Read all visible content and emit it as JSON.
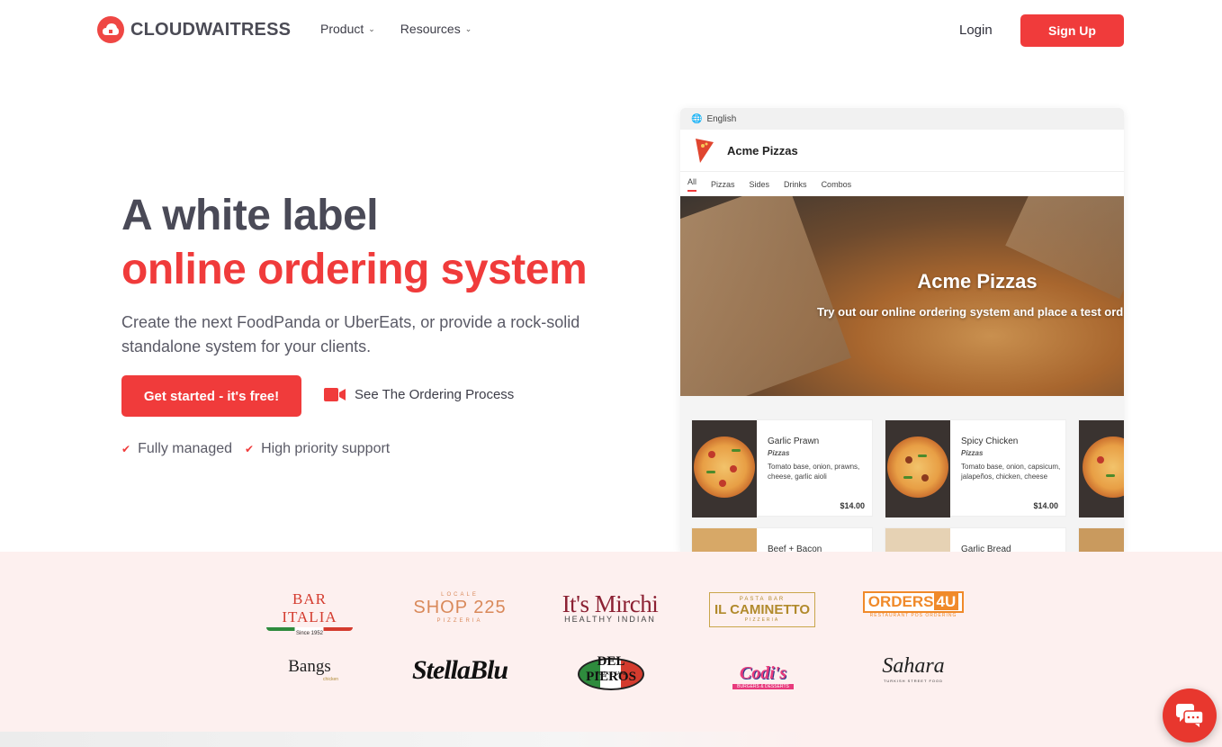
{
  "header": {
    "logo_text": "CLOUDWAITRESS",
    "nav": [
      {
        "label": "Product"
      },
      {
        "label": "Resources"
      }
    ],
    "login_label": "Login",
    "signup_label": "Sign Up"
  },
  "hero": {
    "title_line1": "A white label",
    "title_line2": "online ordering system",
    "subtitle": "Create the next FoodPanda or UberEats, or provide a rock-solid standalone system for your clients.",
    "cta_label": "Get started - it's free!",
    "video_link_label": "See The Ordering Process",
    "checks": [
      "Fully managed",
      "High priority support"
    ]
  },
  "mockup": {
    "language": "English",
    "store_name": "Acme Pizzas",
    "tabs": [
      "All",
      "Pizzas",
      "Sides",
      "Drinks",
      "Combos"
    ],
    "banner_title": "Acme Pizzas",
    "banner_subtitle": "Try out our online ordering system and place a test ord",
    "cards": [
      {
        "name": "Garlic Prawn",
        "category": "Pizzas",
        "description": "Tomato base, onion, prawns, cheese, garlic aioli",
        "price": "$14.00"
      },
      {
        "name": "Spicy Chicken",
        "category": "Pizzas",
        "description": "Tomato base, onion, capsicum, jalapeños, chicken, cheese",
        "price": "$14.00"
      },
      {
        "name": "Beef + Bacon",
        "category": "",
        "description": "",
        "price": ""
      },
      {
        "name": "Garlic Bread",
        "category": "",
        "description": "",
        "price": ""
      }
    ]
  },
  "clients": {
    "bar_italia": {
      "name": "BAR ITALIA",
      "tagline": "Since 1952"
    },
    "shop225": {
      "kicker": "LOCALE",
      "name": "SHOP 225",
      "tagline": "PIZZERIA"
    },
    "mirchi": {
      "name": "It's Mirchi",
      "tagline": "HEALTHY INDIAN"
    },
    "caminetto": {
      "kicker": "PASTA BAR",
      "name": "IL CAMINETTO",
      "tagline": "PIZZERIA"
    },
    "orders4u": {
      "name": "ORDERS",
      "badge": "4U",
      "tagline": "RESTAURANT POS ORDERING"
    },
    "bangs": {
      "name": "Bangs",
      "tagline": "chicken"
    },
    "stellablu": {
      "name": "StellaBlu"
    },
    "delpiero": {
      "name": "DEL PIEROS",
      "tagline": "PIZZA & CAFE"
    },
    "codis": {
      "name": "Codi's",
      "tagline": "BURGERS & DESSERTS"
    },
    "sahara": {
      "name": "Sahara",
      "tagline": "TURKISH STREET FOOD"
    }
  },
  "colors": {
    "accent": "#f03b3b",
    "heading": "#4a4a57",
    "band": "#fdf0ef"
  },
  "icons": {
    "chat": "chat-bubble-icon",
    "video": "video-camera-icon",
    "check": "check-icon",
    "globe": "globe-icon"
  }
}
